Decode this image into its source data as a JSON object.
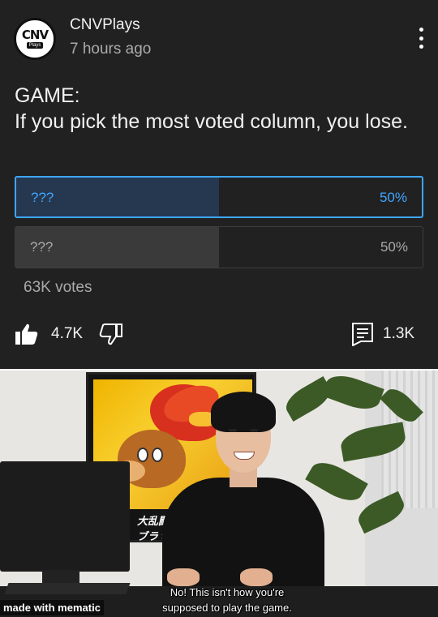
{
  "post": {
    "channel_name": "CNVPlays",
    "time_ago": "7 hours ago",
    "avatar_logo": "CNV",
    "avatar_logo_sub": "Plays",
    "text_line1": "GAME:",
    "text_line2": "If you pick the most voted column, you lose."
  },
  "poll": {
    "options": [
      {
        "label": "???",
        "percent_text": "50%",
        "fraction": 0.5,
        "selected": true
      },
      {
        "label": "???",
        "percent_text": "50%",
        "fraction": 0.5,
        "selected": false
      }
    ],
    "votes": "63K votes"
  },
  "actions": {
    "likes": "4.7K",
    "comments": "1.3K",
    "icons": [
      "thumb-up-icon",
      "thumb-down-icon",
      "comment-icon",
      "more-vert-icon"
    ]
  },
  "meme": {
    "subtitle_line1": "No! This isn't how you're",
    "subtitle_line2": "supposed to play the game.",
    "poster_logo": "大乱闘 スマブラ ×",
    "watermark": "made with mematic"
  },
  "colors": {
    "card_bg": "#212121",
    "accent_blue": "#3ea6ff",
    "muted_text": "#aaaaaa"
  }
}
